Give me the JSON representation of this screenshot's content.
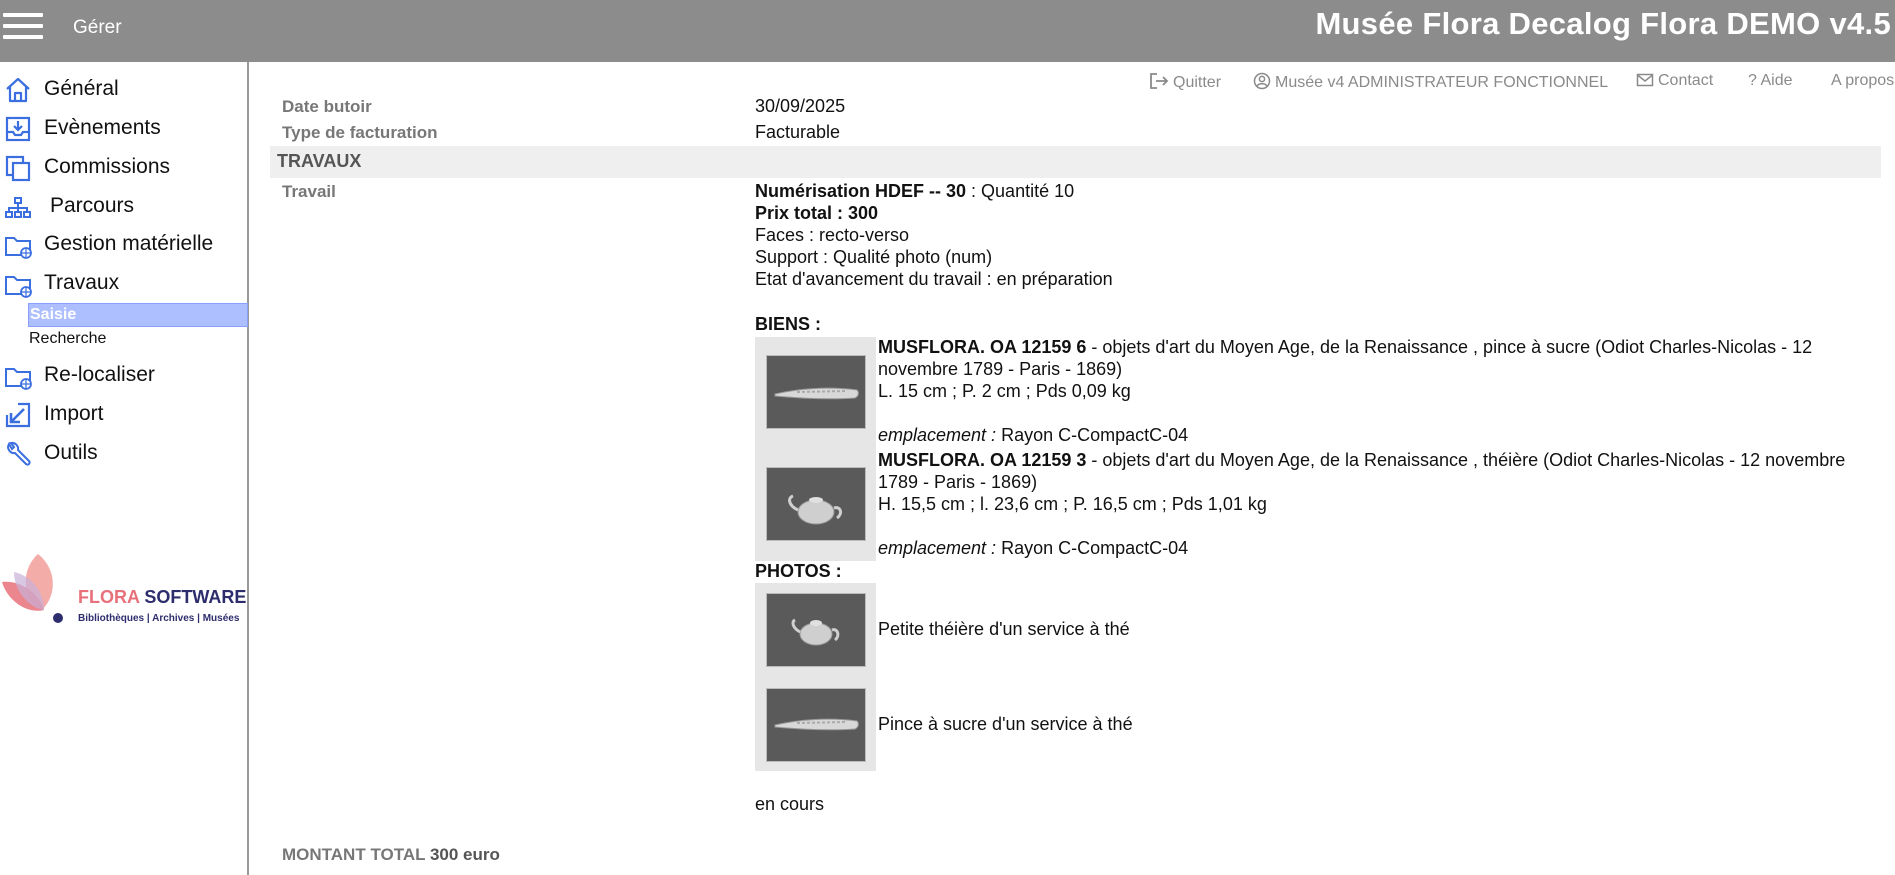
{
  "topbar": {
    "menu_label": "Gérer",
    "app_title": "Musée Flora Decalog Flora DEMO v4.5"
  },
  "sidebar": {
    "items": [
      {
        "label": "Général",
        "icon": "home-icon"
      },
      {
        "label": "Evènements",
        "icon": "inbox-download-icon"
      },
      {
        "label": "Commissions",
        "icon": "copy-icon"
      },
      {
        "label": "Parcours",
        "icon": "sitemap-icon"
      },
      {
        "label": "Gestion matérielle",
        "icon": "folder-globe-icon"
      },
      {
        "label": "Travaux",
        "icon": "folder-globe-icon"
      },
      {
        "label": "Re-localiser",
        "icon": "folder-globe-icon"
      },
      {
        "label": "Import",
        "icon": "arrow-import-icon"
      },
      {
        "label": "Outils",
        "icon": "wrench-icon"
      }
    ],
    "sub_items": [
      {
        "label": "Saisie",
        "active": true
      },
      {
        "label": "Recherche",
        "active": false
      }
    ],
    "logo": {
      "name_part1": "FLORA",
      "name_part2": "SOFTWARE",
      "tagline": "Bibliothèques | Archives | Musées"
    }
  },
  "util_bar": {
    "quit": "Quitter",
    "user": "Musée v4 ADMINISTRATEUR FONCTIONNEL",
    "contact": "Contact",
    "help": "Aide",
    "about": "A propos"
  },
  "record": {
    "fields": [
      {
        "label": "Date butoir",
        "value": "30/09/2025"
      },
      {
        "label": "Type de facturation",
        "value": "Facturable"
      }
    ],
    "section_title": "TRAVAUX",
    "travail_label": "Travail",
    "work": {
      "title_bold": "Numérisation HDEF -- 30",
      "quantity": " : Quantité 10",
      "total_price": "Prix total : 300",
      "faces": "Faces : recto-verso",
      "support": "Support : Qualité photo (num)",
      "status": "Etat d'avancement du travail : en préparation"
    },
    "biens_title": "BIENS :",
    "biens": [
      {
        "id": "MUSFLORA. OA 12159 6",
        "desc": " - objets d'art du Moyen Age, de la Renaissance , pince à sucre (Odiot Charles-Nicolas - 12 novembre 1789 - Paris - 1869)",
        "dims": "L. 15 cm ; P. 2 cm ; Pds 0,09  kg",
        "loc_label": "emplacement :",
        "loc_value": " Rayon C-CompactC-04",
        "image": "sugar-tongs"
      },
      {
        "id": "MUSFLORA. OA 12159 3",
        "desc": " - objets d'art du Moyen Age, de la Renaissance , théière (Odiot Charles-Nicolas - 12 novembre 1789 - Paris - 1869)",
        "dims": "H. 15,5 cm ; l. 23,6 cm ; P. 16,5 cm ; Pds 1,01  kg",
        "loc_label": "emplacement :",
        "loc_value": " Rayon C-CompactC-04",
        "image": "teapot"
      }
    ],
    "photos_title": "PHOTOS :",
    "photos": [
      {
        "caption": "Petite théière d'un service à thé",
        "image": "teapot"
      },
      {
        "caption": "Pince à sucre d'un service à thé",
        "image": "sugar-tongs"
      }
    ],
    "footer_status": "en cours",
    "total_label": "MONTANT TOTAL",
    "total_value": "300 euro"
  },
  "colors": {
    "topbar_bg": "#8c8c8c",
    "icon_blue": "#3b6fe0",
    "active_sub_bg": "#aebfff",
    "section_bg": "#efefef",
    "brand_pink": "#e8707a",
    "brand_navy": "#2d2d6e"
  }
}
